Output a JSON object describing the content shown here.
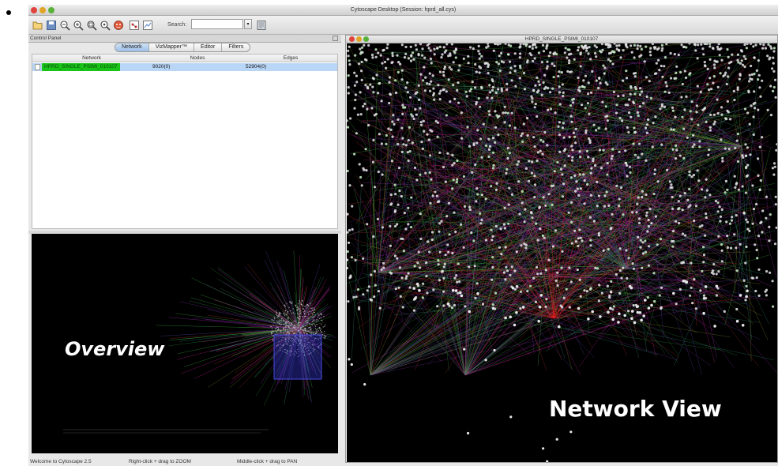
{
  "app": {
    "window_title": "Cytoscape Desktop (Session: hprd_all.cys)"
  },
  "toolbar": {
    "search_label": "Search:",
    "search_value": "",
    "icons": [
      "open-folder-icon",
      "save-icon",
      "zoom-out-icon",
      "zoom-in-icon",
      "zoom-selected-icon",
      "zoom-fit-icon",
      "vizmapper-icon",
      "new-network-icon",
      "new-view-icon",
      "help-icon"
    ]
  },
  "control_panel": {
    "title": "Control Panel",
    "tabs": [
      {
        "label": "Network",
        "active": true
      },
      {
        "label": "VizMapper™",
        "active": false
      },
      {
        "label": "Editor",
        "active": false
      },
      {
        "label": "Filters",
        "active": false
      }
    ],
    "table": {
      "columns": [
        "Network",
        "Nodes",
        "Edges"
      ],
      "rows": [
        {
          "network": "HPRD_SINGLE_PSIMI_010107",
          "nodes": "9020(0)",
          "edges": "52904(0)"
        }
      ]
    },
    "overview_label": "Overview"
  },
  "network_view": {
    "title": "HPRD_SINGLE_PSIMI_010107",
    "label": "Network View"
  },
  "status": {
    "welcome": "Welcome to Cytoscape 2.5",
    "zoom_hint": "Right-click + drag to ZOOM",
    "pan_hint": "Middle-click + drag to PAN"
  },
  "colors": {
    "selected_row": "#b9d6f7",
    "network_name_highlight": "#18c418",
    "canvas_background": "#000000"
  }
}
